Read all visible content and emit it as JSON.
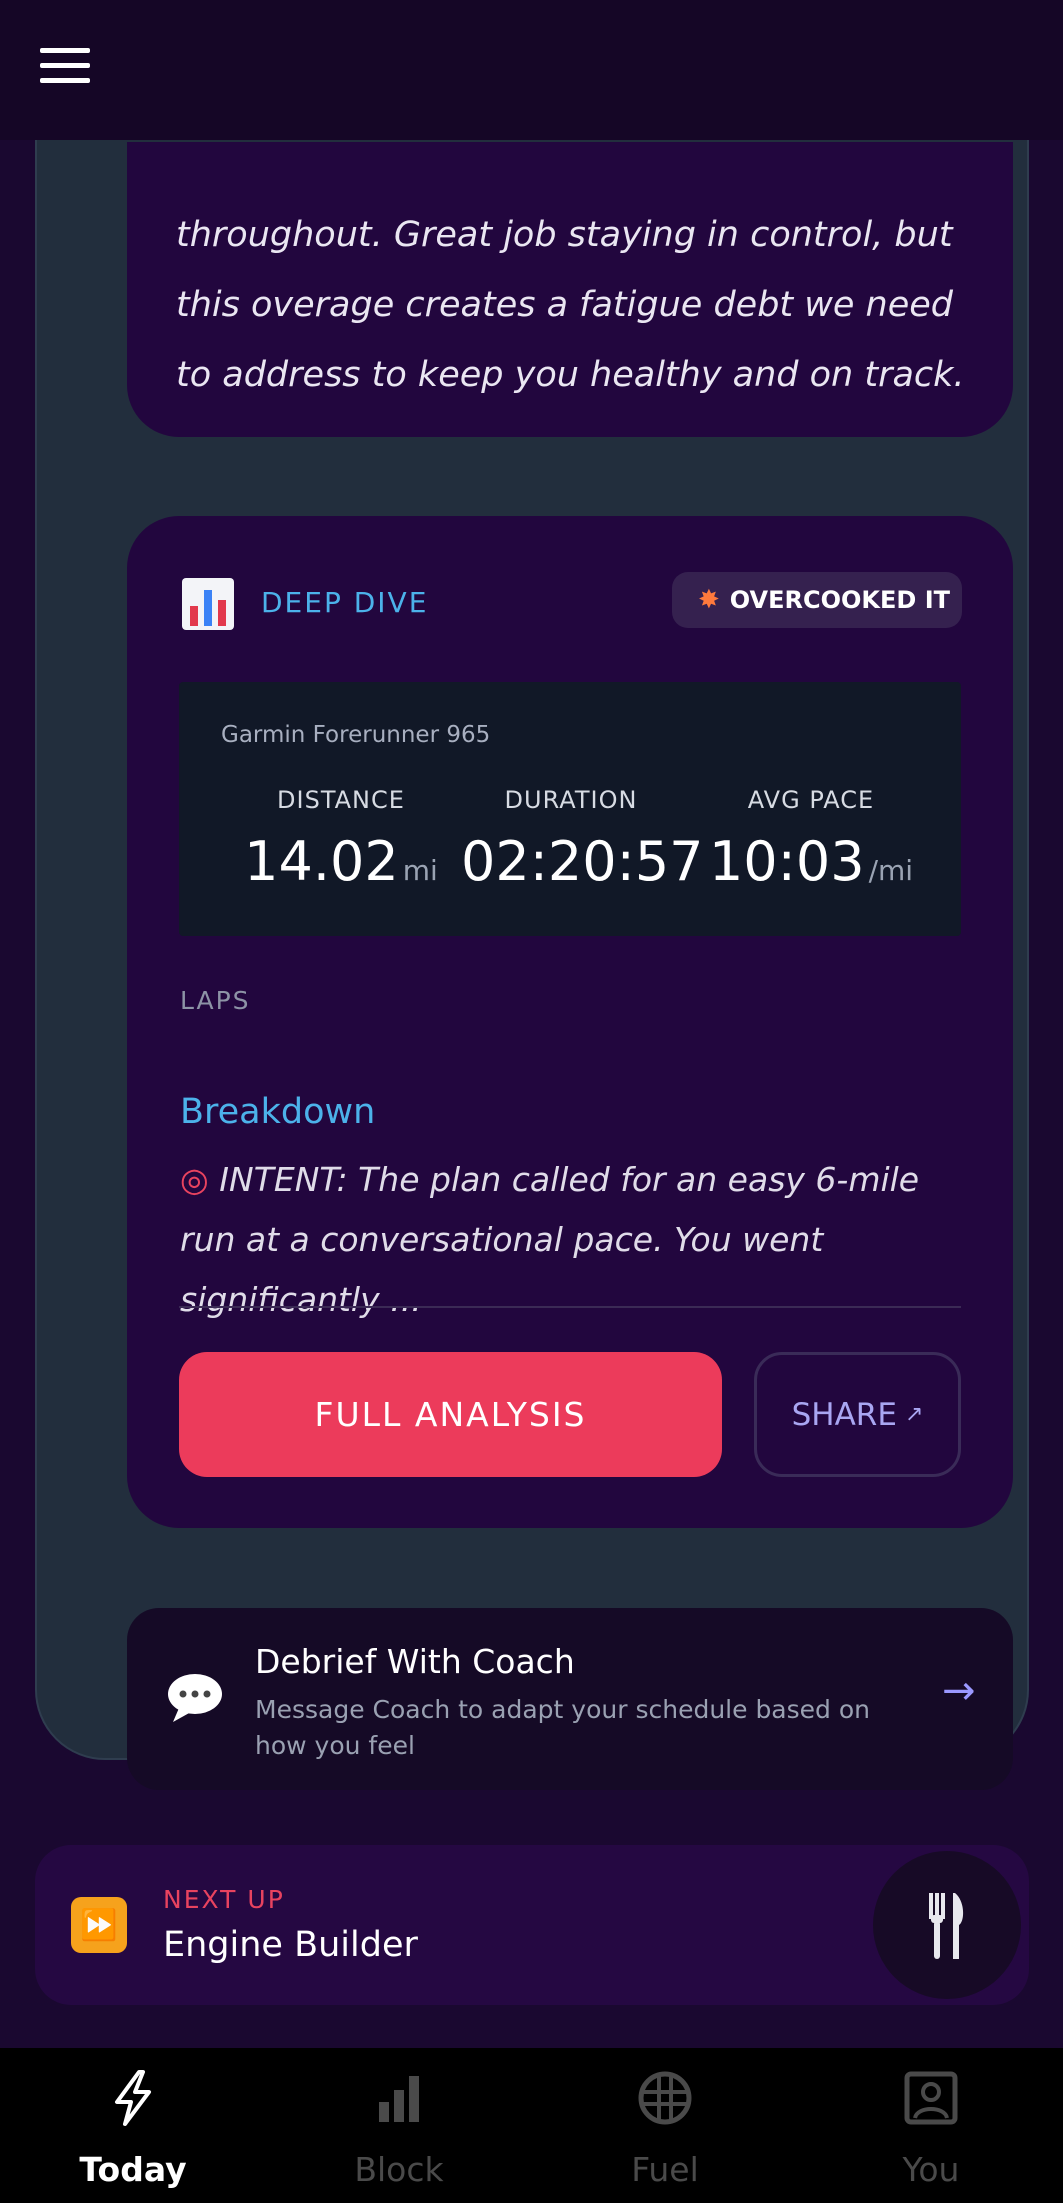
{
  "summary": {
    "text": "throughout. Great job staying in control, but this overage creates a fatigue debt we need to address to keep you healthy and on track."
  },
  "deep_dive": {
    "label": "DEEP DIVE",
    "icon": "bar-chart-icon",
    "badge_icon": "collision-icon",
    "badge": "OVERCOOKED IT",
    "device": "Garmin Forerunner 965",
    "stats": [
      {
        "label": "DISTANCE",
        "value": "14.02",
        "unit": "mi"
      },
      {
        "label": "DURATION",
        "value": "02:20:57",
        "unit": ""
      },
      {
        "label": "AVG PACE",
        "value": "10:03",
        "unit": "/mi"
      }
    ],
    "laps_label": "LAPS",
    "breakdown_title": "Breakdown",
    "intent_icon": "target-icon",
    "intent_text": "INTENT: The plan called for an easy 6-mile run at a conversational pace. You went significantly ...",
    "full_analysis": "FULL ANALYSIS",
    "share": "SHARE",
    "share_icon": "arrow-up-right-icon"
  },
  "debrief": {
    "icon": "speech-bubble-icon",
    "title": "Debrief With Coach",
    "subtitle": "Message Coach to adapt your schedule based on how you feel",
    "arrow_icon": "arrow-right-icon"
  },
  "next_up": {
    "icon": "fast-forward-icon",
    "label": "NEXT UP",
    "title": "Engine Builder",
    "fab_icon": "fork-knife-icon"
  },
  "tabs": [
    {
      "label": "Today",
      "icon": "lightning-icon",
      "active": true
    },
    {
      "label": "Block",
      "icon": "bar-chart-icon",
      "active": false
    },
    {
      "label": "Fuel",
      "icon": "globe-icon",
      "active": false
    },
    {
      "label": "You",
      "icon": "person-icon",
      "active": false
    }
  ],
  "colors": {
    "background": "#1a0830",
    "card": "#222e3d",
    "panel": "#22063e",
    "accent_blue": "#4cb2ea",
    "accent_red": "#ec3b5b",
    "accent_purple": "#9b99ff"
  }
}
